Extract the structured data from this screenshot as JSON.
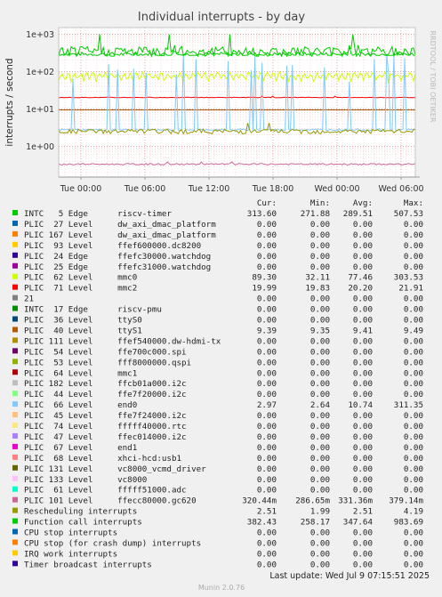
{
  "chart_data": {
    "type": "line",
    "title": "Individual interrupts - by day",
    "ylabel": "interrupts / second",
    "y_scale": "log",
    "ylim": [
      0.15,
      1500
    ],
    "y_ticks": [
      {
        "value": 1000,
        "label": "1e+03"
      },
      {
        "value": 100,
        "label": "1e+02"
      },
      {
        "value": 10,
        "label": "1e+01"
      },
      {
        "value": 1,
        "label": "1e+00"
      }
    ],
    "x_ticks": [
      "Tue 00:00",
      "Tue 06:00",
      "Tue 12:00",
      "Tue 18:00",
      "Wed 00:00",
      "Wed 06:00"
    ],
    "grid": true,
    "side_label": "RRDTOOL / TOBI OETIKER",
    "legend_header": {
      "cur": "Cur:",
      "min": "Min:",
      "avg": "Avg:",
      "max": "Max:"
    },
    "series": [
      {
        "name": "INTC   5 Edge      riscv-timer",
        "color": "#00cc00",
        "cur": "313.60",
        "min": "271.88",
        "avg": "289.51",
        "max": "507.53"
      },
      {
        "name": "PLIC  27 Level     dw_axi_dmac_platform",
        "color": "#0066b3",
        "cur": "0.00",
        "min": "0.00",
        "avg": "0.00",
        "max": "0.00"
      },
      {
        "name": "PLIC 167 Level     dw_axi_dmac_platform",
        "color": "#ff8000",
        "cur": "0.00",
        "min": "0.00",
        "avg": "0.00",
        "max": "0.00"
      },
      {
        "name": "PLIC  93 Level     ffef600000.dc8200",
        "color": "#ffcc00",
        "cur": "0.00",
        "min": "0.00",
        "avg": "0.00",
        "max": "0.00"
      },
      {
        "name": "PLIC  24 Edge      ffefc30000.watchdog",
        "color": "#330099",
        "cur": "0.00",
        "min": "0.00",
        "avg": "0.00",
        "max": "0.00"
      },
      {
        "name": "PLIC  25 Edge      ffefc31000.watchdog",
        "color": "#990099",
        "cur": "0.00",
        "min": "0.00",
        "avg": "0.00",
        "max": "0.00"
      },
      {
        "name": "PLIC  62 Level     mmc0",
        "color": "#ccff00",
        "cur": "89.30",
        "min": "32.11",
        "avg": "77.46",
        "max": "303.53"
      },
      {
        "name": "PLIC  71 Level     mmc2",
        "color": "#ff0000",
        "cur": "19.99",
        "min": "19.83",
        "avg": "20.20",
        "max": "21.91"
      },
      {
        "name": "21",
        "color": "#808080",
        "cur": "0.00",
        "min": "0.00",
        "avg": "0.00",
        "max": "0.00"
      },
      {
        "name": "INTC  17 Edge      riscv-pmu",
        "color": "#008f00",
        "cur": "0.00",
        "min": "0.00",
        "avg": "0.00",
        "max": "0.00"
      },
      {
        "name": "PLIC  36 Level     ttyS0",
        "color": "#00487d",
        "cur": "0.00",
        "min": "0.00",
        "avg": "0.00",
        "max": "0.00"
      },
      {
        "name": "PLIC  40 Level     ttyS1",
        "color": "#b35a00",
        "cur": "9.39",
        "min": "9.35",
        "avg": "9.41",
        "max": "9.49"
      },
      {
        "name": "PLIC 111 Level     ffef540000.dw-hdmi-tx",
        "color": "#b38f00",
        "cur": "0.00",
        "min": "0.00",
        "avg": "0.00",
        "max": "0.00"
      },
      {
        "name": "PLIC  54 Level     ffe700c000.spi",
        "color": "#6b006b",
        "cur": "0.00",
        "min": "0.00",
        "avg": "0.00",
        "max": "0.00"
      },
      {
        "name": "PLIC  53 Level     fff8000000.qspi",
        "color": "#8fb300",
        "cur": "0.00",
        "min": "0.00",
        "avg": "0.00",
        "max": "0.00"
      },
      {
        "name": "PLIC  64 Level     mmc1",
        "color": "#b30000",
        "cur": "0.00",
        "min": "0.00",
        "avg": "0.00",
        "max": "0.00"
      },
      {
        "name": "PLIC 182 Level     ffcb01a000.i2c",
        "color": "#bebebe",
        "cur": "0.00",
        "min": "0.00",
        "avg": "0.00",
        "max": "0.00"
      },
      {
        "name": "PLIC  44 Level     ffe7f20000.i2c",
        "color": "#80ff80",
        "cur": "0.00",
        "min": "0.00",
        "avg": "0.00",
        "max": "0.00"
      },
      {
        "name": "PLIC  66 Level     end0",
        "color": "#80c9ff",
        "cur": "2.97",
        "min": "2.64",
        "avg": "10.74",
        "max": "311.35"
      },
      {
        "name": "PLIC  45 Level     ffe7f24000.i2c",
        "color": "#ffc080",
        "cur": "0.00",
        "min": "0.00",
        "avg": "0.00",
        "max": "0.00"
      },
      {
        "name": "PLIC  74 Level     fffff40000.rtc",
        "color": "#ffe680",
        "cur": "0.00",
        "min": "0.00",
        "avg": "0.00",
        "max": "0.00"
      },
      {
        "name": "PLIC  47 Level     ffec014000.i2c",
        "color": "#aa80ff",
        "cur": "0.00",
        "min": "0.00",
        "avg": "0.00",
        "max": "0.00"
      },
      {
        "name": "PLIC  67 Level     end1",
        "color": "#ee00cc",
        "cur": "0.00",
        "min": "0.00",
        "avg": "0.00",
        "max": "0.00"
      },
      {
        "name": "PLIC  68 Level     xhci-hcd:usb1",
        "color": "#ff8080",
        "cur": "0.00",
        "min": "0.00",
        "avg": "0.00",
        "max": "0.00"
      },
      {
        "name": "PLIC 131 Level     vc8000_vcmd_driver",
        "color": "#666600",
        "cur": "0.00",
        "min": "0.00",
        "avg": "0.00",
        "max": "0.00"
      },
      {
        "name": "PLIC 133 Level     vc8000",
        "color": "#ffbfff",
        "cur": "0.00",
        "min": "0.00",
        "avg": "0.00",
        "max": "0.00"
      },
      {
        "name": "PLIC  61 Level     fffff51000.adc",
        "color": "#00ffcc",
        "cur": "0.00",
        "min": "0.00",
        "avg": "0.00",
        "max": "0.00"
      },
      {
        "name": "PLIC 101 Level     ffecc80000.gc620",
        "color": "#cc6699",
        "cur": "320.44m",
        "min": "286.65m",
        "avg": "331.36m",
        "max": "379.14m"
      },
      {
        "name": "Rescheduling interrupts",
        "color": "#999900",
        "cur": "2.51",
        "min": "1.99",
        "avg": "2.51",
        "max": "4.19"
      },
      {
        "name": "Function call interrupts",
        "color": "#00cc00",
        "cur": "382.43",
        "min": "258.17",
        "avg": "347.64",
        "max": "983.69"
      },
      {
        "name": "CPU stop interrupts",
        "color": "#0066b3",
        "cur": "0.00",
        "min": "0.00",
        "avg": "0.00",
        "max": "0.00"
      },
      {
        "name": "CPU stop (for crash dump) interrupts",
        "color": "#ff8000",
        "cur": "0.00",
        "min": "0.00",
        "avg": "0.00",
        "max": "0.00"
      },
      {
        "name": "IRQ work interrupts",
        "color": "#ffcc00",
        "cur": "0.00",
        "min": "0.00",
        "avg": "0.00",
        "max": "0.00"
      },
      {
        "name": "Timer broadcast interrupts",
        "color": "#330099",
        "cur": "0.00",
        "min": "0.00",
        "avg": "0.00",
        "max": "0.00"
      }
    ],
    "last_update": "Last update: Wed Jul  9 07:15:51 2025",
    "footer": "Munin 2.0.76"
  }
}
